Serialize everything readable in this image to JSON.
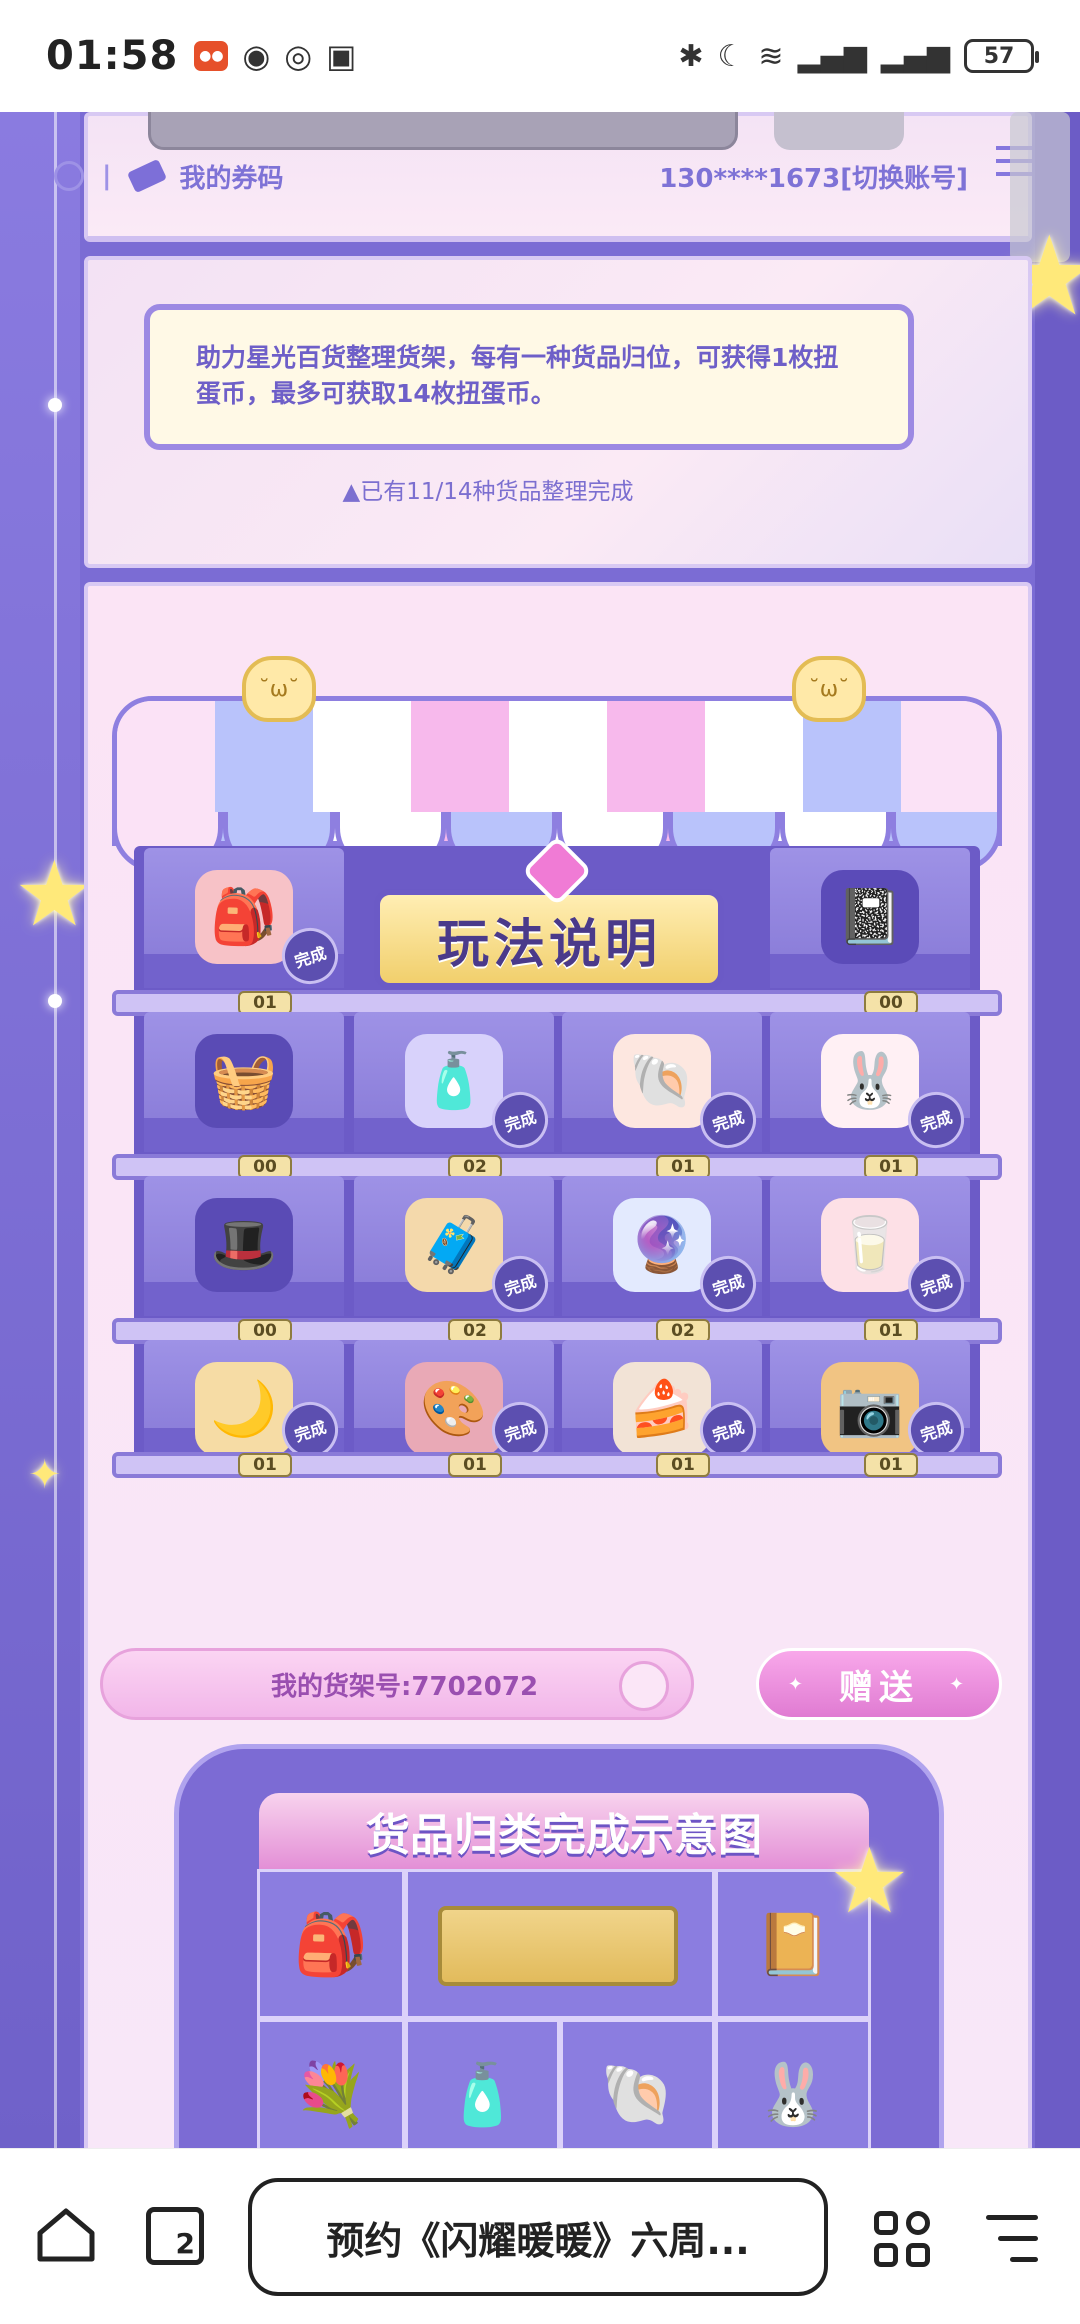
{
  "status_bar": {
    "time": "01:58",
    "battery": "57",
    "network": "5"
  },
  "header": {
    "my_coupon": "我的券码",
    "account": "130****1673[切换账号]"
  },
  "notice": {
    "text": "助力星光百货整理货架，每有一种货品归位，可获得1枚扭蛋币，最多可获取14枚扭蛋币。",
    "progress": "已有11/14种货品整理完成"
  },
  "shelf": {
    "howto_label": "玩法说明",
    "done_label": "完成",
    "counts": [
      "01",
      "00",
      "00",
      "02",
      "01",
      "01",
      "00",
      "02",
      "02",
      "01",
      "01",
      "01",
      "01",
      "01"
    ]
  },
  "actions": {
    "shelf_number": "我的货架号:7702072",
    "gift_button": "赠送"
  },
  "legend": {
    "title": "货品归类完成示意图"
  },
  "browser": {
    "url_title": "预约《闪耀暖暖》六周...",
    "tab_count": "2"
  }
}
